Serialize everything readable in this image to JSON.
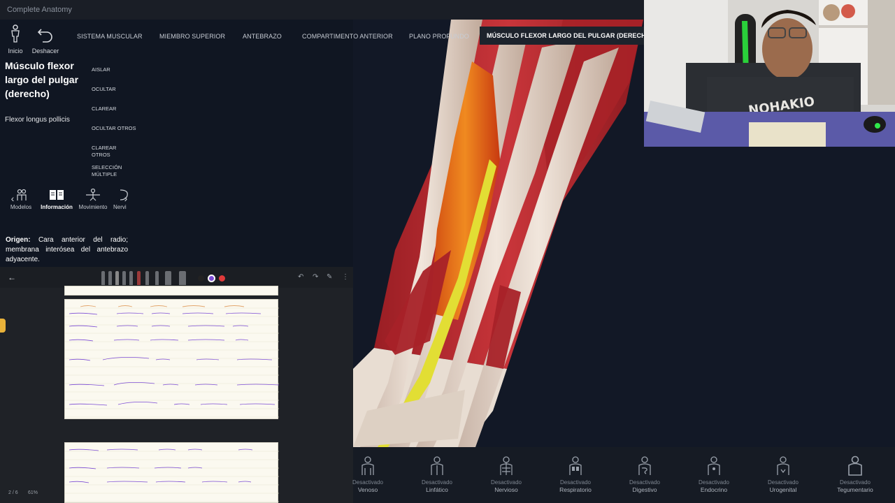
{
  "app": {
    "title": "Complete Anatomy"
  },
  "toolbar": {
    "home_label": "Inicio",
    "undo_label": "Deshacer"
  },
  "breadcrumb": [
    "SISTEMA MUSCULAR",
    "MIEMBRO SUPERIOR",
    "ANTEBRAZO",
    "COMPARTIMENTO ANTERIOR",
    "PLANO PROFUNDO",
    "MÚSCULO FLEXOR LARGO DEL PULGAR (DERECHO)"
  ],
  "structure": {
    "title": "Músculo flexor largo del pulgar (derecho)",
    "latin": "Flexor longus pollicis"
  },
  "actions": [
    "AISLAR",
    "OCULTAR",
    "CLAREAR",
    "OCULTAR OTROS",
    "CLAREAR OTROS",
    "SELECCIÓN MÚLTIPLE"
  ],
  "tabs": [
    {
      "label": "Modelos",
      "icon": "models-icon"
    },
    {
      "label": "Información",
      "icon": "book-icon",
      "active": true
    },
    {
      "label": "Movimiento",
      "icon": "movement-icon"
    },
    {
      "label": "Nervi",
      "icon": "nerve-icon"
    }
  ],
  "origin": {
    "label": "Origen:",
    "text": "Cara anterior del radio; membrana interósea del antebrazo adyacente."
  },
  "notes": {
    "page_indicator": "2 / 6",
    "zoom": "61%",
    "colors": {
      "ink_black": "#222222",
      "ink_purple": "#7b4bd4",
      "ink_red": "#e03a3a",
      "highlight": "#e8b23a"
    }
  },
  "systems": [
    {
      "state": "Desactivado",
      "name": "Venoso",
      "icon": "venous-icon"
    },
    {
      "state": "Desactivado",
      "name": "Linfático",
      "icon": "lymphatic-icon"
    },
    {
      "state": "Desactivado",
      "name": "Nervioso",
      "icon": "nervous-icon"
    },
    {
      "state": "Desactivado",
      "name": "Respiratorio",
      "icon": "respiratory-icon"
    },
    {
      "state": "Desactivado",
      "name": "Digestivo",
      "icon": "digestive-icon"
    },
    {
      "state": "Desactivado",
      "name": "Endocrino",
      "icon": "endocrine-icon"
    },
    {
      "state": "Desactivado",
      "name": "Urogenital",
      "icon": "urogenital-icon"
    },
    {
      "state": "Desactivado",
      "name": "Tegumentario",
      "icon": "integumentary-icon"
    }
  ],
  "colors": {
    "muscle_selected": "#e86a1a",
    "muscle": "#b8282e",
    "tendon": "#ead9cc",
    "nerve": "#e6e23a",
    "background": "#101622"
  }
}
